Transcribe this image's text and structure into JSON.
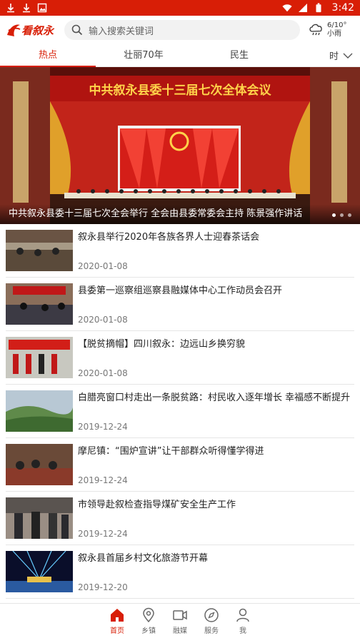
{
  "status_bar": {
    "time": "3:42",
    "icons": [
      "download-icon",
      "download-icon",
      "gallery-icon",
      "wifi-icon",
      "signal-icon",
      "battery-icon"
    ]
  },
  "header": {
    "logo_text": "看叙永",
    "search_placeholder": "输入搜索关键词",
    "weather_temp": "6/10°",
    "weather_desc": "小雨"
  },
  "tabs": [
    {
      "label": "热点",
      "active": true
    },
    {
      "label": "壮丽70年",
      "active": false
    },
    {
      "label": "民生",
      "active": false
    },
    {
      "label": "时",
      "active": false
    }
  ],
  "banner": {
    "headline_banner": "中共叙永县委十三届七次全体会议",
    "caption": "中共叙永县委十三届七次全会举行 全会由县委常委会主持 陈景强作讲话"
  },
  "articles": [
    {
      "title": "叙永县举行2020年各族各界人士迎春茶话会",
      "date": "2020-01-08"
    },
    {
      "title": "县委第一巡察组巡察县融媒体中心工作动员会召开",
      "date": "2020-01-08"
    },
    {
      "title": "【脱贫摘帽】四川叙永：边远山乡换穷貌",
      "date": "2020-01-08"
    },
    {
      "title": "白腊亮窗口村走出一条脱贫路：村民收入逐年增长 幸福感不断提升",
      "date": "2019-12-24"
    },
    {
      "title": "摩尼镇：“围炉宣讲”让干部群众听得懂学得进",
      "date": "2019-12-24"
    },
    {
      "title": "市领导赴叙检查指导煤矿安全生产工作",
      "date": "2019-12-24"
    },
    {
      "title": "叙永县首届乡村文化旅游节开幕",
      "date": "2019-12-20"
    }
  ],
  "bottom_nav": [
    {
      "label": "首页",
      "icon": "home-icon",
      "active": true
    },
    {
      "label": "乡镇",
      "icon": "location-icon",
      "active": false
    },
    {
      "label": "融媒",
      "icon": "video-icon",
      "active": false
    },
    {
      "label": "服务",
      "icon": "compass-icon",
      "active": false
    },
    {
      "label": "我",
      "icon": "user-icon",
      "active": false
    }
  ],
  "colors": {
    "accent": "#d81e06"
  }
}
